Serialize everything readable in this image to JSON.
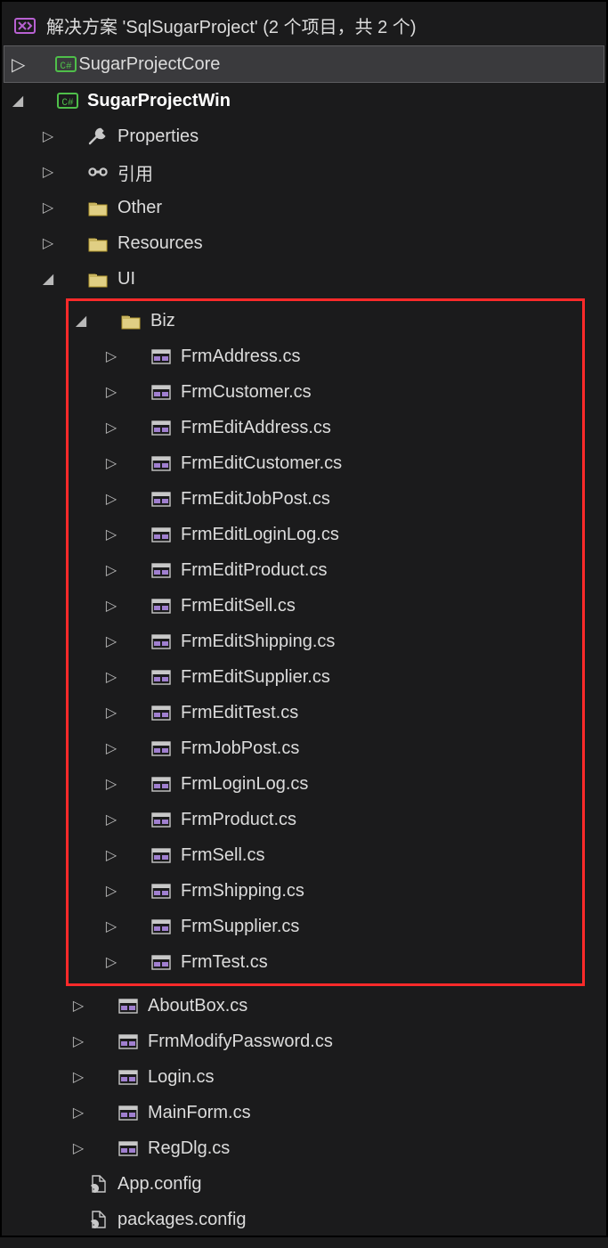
{
  "solution_title": "解决方案 'SqlSugarProject' (2 个项目，共 2 个)",
  "projects": [
    {
      "name": "SugarProjectCore",
      "bold": false
    },
    {
      "name": "SugarProjectWin",
      "bold": true
    }
  ],
  "win_nodes": [
    {
      "label": "Properties",
      "icon": "wrench",
      "caret": "r"
    },
    {
      "label": "引用",
      "icon": "ref",
      "caret": "r"
    },
    {
      "label": "Other",
      "icon": "folder",
      "caret": "r"
    },
    {
      "label": "Resources",
      "icon": "folder",
      "caret": "r"
    },
    {
      "label": "UI",
      "icon": "folder",
      "caret": "d"
    }
  ],
  "biz_label": "Biz",
  "biz_items": [
    "FrmAddress.cs",
    "FrmCustomer.cs",
    "FrmEditAddress.cs",
    "FrmEditCustomer.cs",
    "FrmEditJobPost.cs",
    "FrmEditLoginLog.cs",
    "FrmEditProduct.cs",
    "FrmEditSell.cs",
    "FrmEditShipping.cs",
    "FrmEditSupplier.cs",
    "FrmEditTest.cs",
    "FrmJobPost.cs",
    "FrmLoginLog.cs",
    "FrmProduct.cs",
    "FrmSell.cs",
    "FrmShipping.cs",
    "FrmSupplier.cs",
    "FrmTest.cs"
  ],
  "ui_items": [
    "AboutBox.cs",
    "FrmModifyPassword.cs",
    "Login.cs",
    "MainForm.cs",
    "RegDlg.cs"
  ],
  "config_items": [
    "App.config",
    "packages.config"
  ]
}
